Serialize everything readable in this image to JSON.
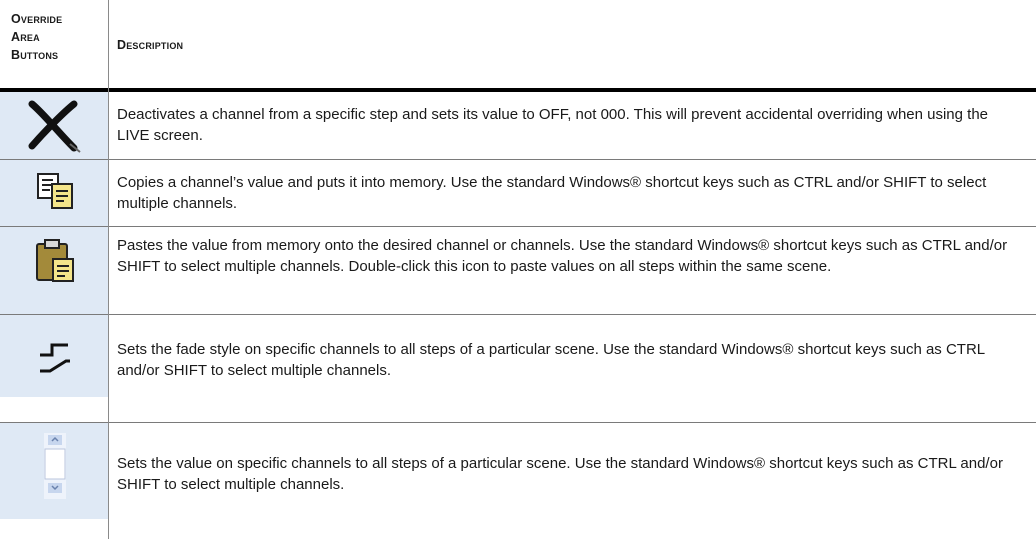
{
  "header": {
    "col1_lines": [
      "Override",
      "Area",
      "Buttons"
    ],
    "col2": "Description"
  },
  "rows": [
    {
      "icon": "deactivate-x-icon",
      "description": "Deactivates a channel from a specific step and sets its value to OFF, not 000.  This will prevent accidental overriding when using the LIVE screen."
    },
    {
      "icon": "copy-icon",
      "description": "Copies a channel’s value and puts it into memory. Use the standard Windows® shortcut keys such as CTRL and/or SHIFT to select multiple channels."
    },
    {
      "icon": "paste-icon",
      "description": "Pastes the value from memory onto the desired channel or channels. Use the standard Windows® shortcut keys such as CTRL and/or SHIFT to select multiple channels. Double-click this icon to paste values on all steps within the same scene."
    },
    {
      "icon": "fade-style-icon",
      "description": "Sets the fade style on specific channels to all steps of a particular scene. Use the standard Windows® shortcut keys such as CTRL and/or SHIFT to select multiple channels."
    },
    {
      "icon": "set-value-icon",
      "description": "Sets the value on specific channels to all steps of a particular scene. Use the standard Windows® shortcut keys such as CTRL and/or SHIFT to select multiple channels."
    }
  ],
  "colors": {
    "icon_cell_bg": "#dfe9f5",
    "rule": "#7a7a7a",
    "text": "#1a1a1a"
  }
}
